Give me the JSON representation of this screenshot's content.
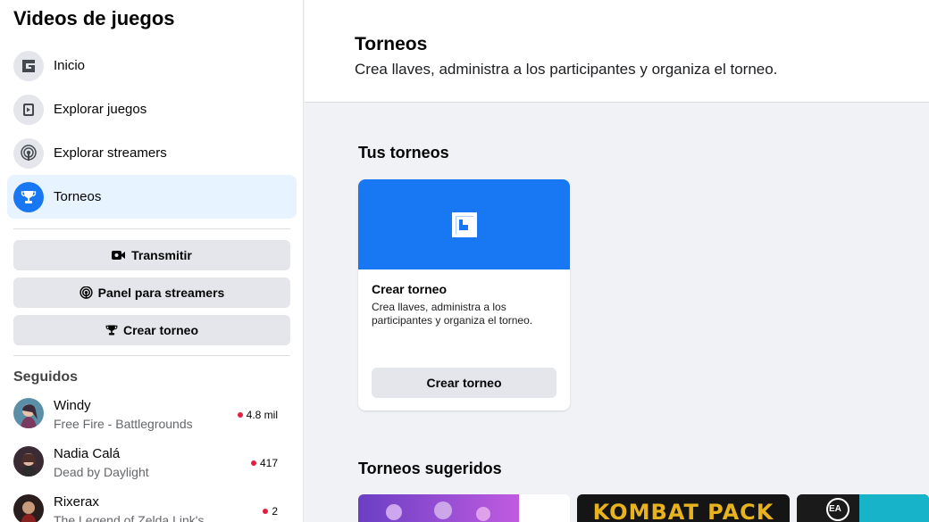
{
  "sidebar": {
    "title": "Videos de juegos",
    "nav": [
      {
        "label": "Inicio",
        "icon": "gaming-home-icon"
      },
      {
        "label": "Explorar juegos",
        "icon": "game-explore-icon"
      },
      {
        "label": "Explorar streamers",
        "icon": "broadcast-icon"
      },
      {
        "label": "Torneos",
        "icon": "trophy-icon",
        "active": true
      }
    ],
    "buttons": {
      "stream": "Transmitir",
      "creator_panel": "Panel para streamers",
      "create_tournament": "Crear torneo"
    },
    "following": {
      "title": "Seguidos",
      "items": [
        {
          "name": "Windy",
          "game": "Free Fire - Battlegrounds",
          "viewers": "4.8 mil"
        },
        {
          "name": "Nadia Calá",
          "game": "Dead by Daylight",
          "viewers": "417"
        },
        {
          "name": "Rixerax",
          "game": "The Legend of Zelda Link's",
          "viewers": "2"
        }
      ]
    }
  },
  "header": {
    "title": "Torneos",
    "subtitle": "Crea llaves, administra a los participantes y organiza el torneo."
  },
  "your_tournaments": {
    "title": "Tus torneos",
    "card": {
      "title": "Crear torneo",
      "description": "Crea llaves, administra a los participantes y organiza el torneo.",
      "button": "Crear torneo"
    }
  },
  "suggested": {
    "title": "Torneos sugeridos",
    "thumbs": [
      {
        "text": ""
      },
      {
        "text": "KOMBAT PACK"
      },
      {
        "text": "EA"
      }
    ]
  },
  "colors": {
    "accent": "#1877f2",
    "active_bg": "#e7f3ff",
    "live": "#e41e3f"
  }
}
